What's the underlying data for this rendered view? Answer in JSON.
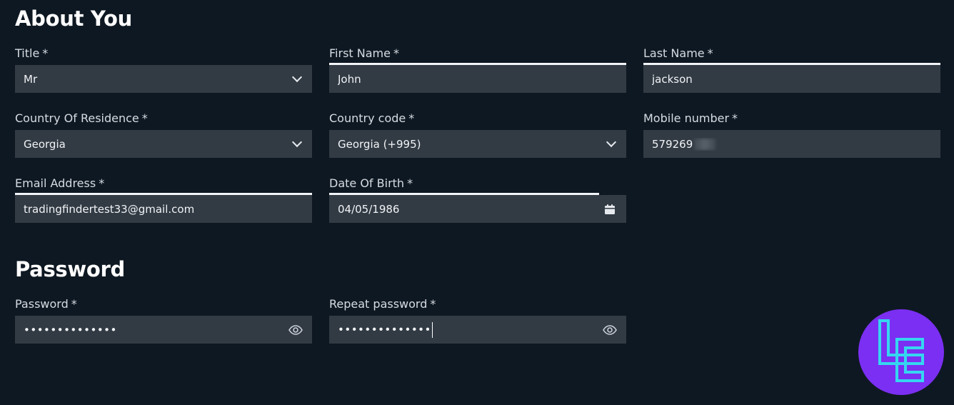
{
  "sections": {
    "about": {
      "title": "About You"
    },
    "password": {
      "title": "Password"
    }
  },
  "fields": {
    "title": {
      "label": "Title",
      "required": "*",
      "value": "Mr"
    },
    "first_name": {
      "label": "First Name",
      "required": "*",
      "value": "John"
    },
    "last_name": {
      "label": "Last Name",
      "required": "*",
      "value": "jackson"
    },
    "country": {
      "label": "Country Of Residence",
      "required": "*",
      "value": "Georgia"
    },
    "country_code": {
      "label": "Country code",
      "required": "*",
      "value": "Georgia (+995)"
    },
    "mobile": {
      "label": "Mobile number",
      "required": "*",
      "value": "579269"
    },
    "email": {
      "label": "Email Address",
      "required": "*",
      "value": "tradingfindertest33@gmail.com"
    },
    "dob": {
      "label": "Date Of Birth",
      "required": "*",
      "value": "04/05/1986"
    },
    "password": {
      "label": "Password",
      "required": "*",
      "value": "••••••••••••••"
    },
    "repeat_password": {
      "label": "Repeat password",
      "required": "*",
      "value": "••••••••••••••"
    }
  },
  "icons": {
    "select": "chevron-down-icon",
    "date": "calendar-icon",
    "reveal": "eye-icon",
    "logo": "tradingfinder-logo"
  },
  "colors": {
    "background": "#0e1822",
    "input": "#323b44",
    "logo_bg": "#7b2ff2",
    "logo_mark": "#35d6f0"
  }
}
